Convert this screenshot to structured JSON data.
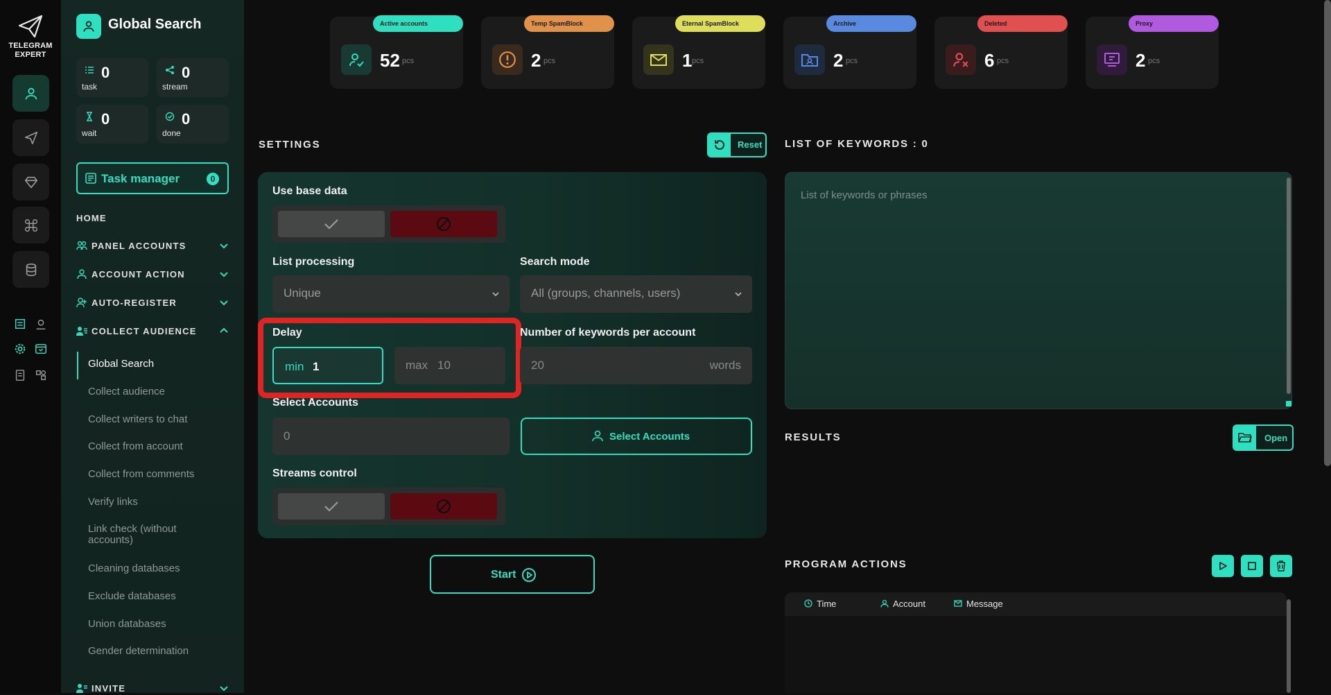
{
  "brand": {
    "line1": "TELEGRAM",
    "line2": "EXPERT"
  },
  "sidebar": {
    "title": "Global Search",
    "stats": [
      {
        "value": "0",
        "label": "task"
      },
      {
        "value": "0",
        "label": "stream"
      },
      {
        "value": "0",
        "label": "wait"
      },
      {
        "value": "0",
        "label": "done"
      }
    ],
    "task_manager": {
      "label": "Task manager",
      "count": "0"
    },
    "nav": {
      "home": "HOME",
      "panel_accounts": "PANEL ACCOUNTS",
      "account_action": "ACCOUNT ACTION",
      "auto_register": "AUTO-REGISTER",
      "collect_audience": "COLLECT AUDIENCE",
      "invite": "INVITE"
    },
    "sub_items": [
      "Global Search",
      "Collect audience",
      "Collect writers to chat",
      "Collect from account",
      "Collect from comments",
      "Verify links",
      "Link check (without accounts)",
      "Cleaning databases",
      "Exclude databases",
      "Union databases",
      "Gender determination"
    ]
  },
  "cards": [
    {
      "label": "Active accounts",
      "value": "52",
      "unit": "pcs",
      "color": "#2fe0c0"
    },
    {
      "label": "Temp SpamBlock",
      "value": "2",
      "unit": "pcs",
      "color": "#e0924a"
    },
    {
      "label": "Eternal SpamBlock",
      "value": "1",
      "unit": "pcs",
      "color": "#dede5a"
    },
    {
      "label": "Archive",
      "value": "2",
      "unit": "pcs",
      "color": "#5a8ae0"
    },
    {
      "label": "Deleted",
      "value": "6",
      "unit": "pcs",
      "color": "#e05050"
    },
    {
      "label": "Proxy",
      "value": "2",
      "unit": "pcs",
      "color": "#b05ae0"
    }
  ],
  "settings": {
    "title": "SETTINGS",
    "reset_label": "Reset",
    "use_base_data": "Use base data",
    "list_processing": {
      "label": "List processing",
      "value": "Unique"
    },
    "search_mode": {
      "label": "Search mode",
      "value": "All (groups, channels, users)"
    },
    "delay": {
      "label": "Delay",
      "min_prefix": "min",
      "min_value": "1",
      "max_prefix": "max",
      "max_value": "10"
    },
    "keywords_per_account": {
      "label": "Number of keywords per account",
      "placeholder": "20",
      "unit": "words"
    },
    "select_accounts": {
      "label": "Select Accounts",
      "value": "0",
      "button": "Select Accounts"
    },
    "streams_control": "Streams control",
    "start_label": "Start"
  },
  "keywords": {
    "title": "LIST OF KEYWORDS : 0",
    "placeholder": "List of keywords or phrases"
  },
  "results": {
    "title": "RESULTS",
    "open_label": "Open"
  },
  "program_actions": {
    "title": "PROGRAM ACTIONS",
    "columns": [
      "Time",
      "Account",
      "Message"
    ]
  },
  "colors": {
    "accent": "#2fe0c0",
    "danger": "#e02424",
    "deny": "#5c0a12"
  }
}
